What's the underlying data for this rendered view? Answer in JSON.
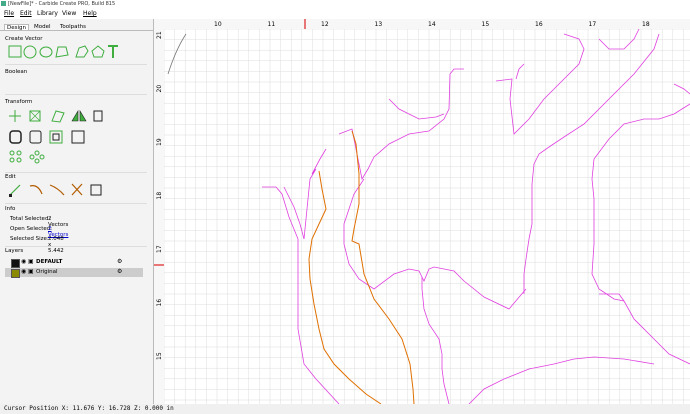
{
  "window": {
    "title": "[NewFile]* - Carbide Create PRO, Build 815"
  },
  "menu": [
    {
      "label": "File",
      "underline": "F"
    },
    {
      "label": "Edit",
      "underline": "E"
    },
    {
      "label": "Library",
      "underline": ""
    },
    {
      "label": "View",
      "underline": ""
    },
    {
      "label": "Help",
      "underline": "H"
    }
  ],
  "tabs": [
    {
      "label": "Design",
      "active": true
    },
    {
      "label": "Model",
      "active": false
    },
    {
      "label": "Toolpaths",
      "active": false
    }
  ],
  "sections": {
    "create_vector": "Create Vector",
    "boolean": "Boolean",
    "transform": "Transform",
    "edit": "Edit",
    "info": "Info",
    "layers": "Layers"
  },
  "info": {
    "total_selected_label": "Total Selected:",
    "total_selected_value": "2 Vectors",
    "open_selected_label": "Open Selected:",
    "open_selected_value": "2 Vectors",
    "selected_size_label": "Selected Size:",
    "selected_size_value": "2.048 x 5.442"
  },
  "layers": [
    {
      "name": "DEFAULT",
      "bold": true,
      "selected": false,
      "swatch": "#111111"
    },
    {
      "name": "Original",
      "bold": false,
      "selected": true,
      "swatch": "#8a8a00"
    }
  ],
  "ruler": {
    "x_labels": [
      "10",
      "11",
      "12",
      "13",
      "14",
      "15",
      "16",
      "17",
      "18"
    ],
    "y_labels": [
      "21",
      "20",
      "19",
      "18",
      "17",
      "16",
      "15"
    ]
  },
  "status": {
    "text": "Cursor Position X: 11.676 Y: 16.728 Z: 0.000 in"
  },
  "colors": {
    "accent_green": "#3fae3f",
    "vector_magenta": "#e040e0",
    "vector_orange": "#e07000",
    "grid": "#dcdcdc",
    "cursor_marker": "#e02020"
  }
}
